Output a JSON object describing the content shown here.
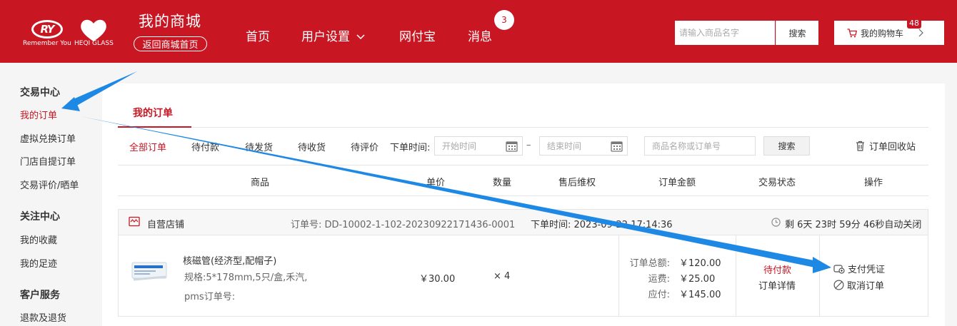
{
  "header": {
    "logo_ry": "RY",
    "logo_ry_sub": "Remember You",
    "logo_heqi_sub": "HEQI GLASS",
    "store_title": "我的商城",
    "back_home": "返回商城首页",
    "nav": [
      {
        "label": "首页"
      },
      {
        "label": "用户设置"
      },
      {
        "label": "网付宝"
      },
      {
        "label": "消息"
      }
    ],
    "message_count": "3",
    "search_placeholder": "请输入商品名字",
    "search_button": "搜索",
    "cart_label": "我的购物车",
    "cart_count": "48",
    "brand_color": "#c81623"
  },
  "sidebar": {
    "sections": [
      {
        "title": "交易中心",
        "items": [
          "我的订单",
          "虚拟兑换订单",
          "门店自提订单",
          "交易评价/晒单"
        ]
      },
      {
        "title": "关注中心",
        "items": [
          "我的收藏",
          "我的足迹"
        ]
      },
      {
        "title": "客户服务",
        "items": [
          "退款及退货"
        ]
      }
    ],
    "active_item": "我的订单"
  },
  "main": {
    "tab": "我的订单",
    "filters": [
      "全部订单",
      "待付款",
      "待发货",
      "待收货",
      "待评价"
    ],
    "active_filter": "全部订单",
    "time_label": "下单时间:",
    "start_placeholder": "开始时间",
    "range_sep": "–",
    "end_placeholder": "结束时间",
    "keyword_placeholder": "商品名称或订单号",
    "search_button": "搜索",
    "recycle_bin": "订单回收站",
    "columns": [
      "商品",
      "单价",
      "数量",
      "售后维权",
      "订单金额",
      "交易状态",
      "操作"
    ]
  },
  "order": {
    "store": "自营店铺",
    "order_no": "订单号:  DD-10002-1-102-20230922171436-0001",
    "order_time": "下单时间:  2023-09-22 17:14:36",
    "countdown": "剩 6天 23时 59分 46秒自动关闭",
    "product": {
      "name": "核磁管(经济型,配帽子)",
      "spec": "规格:5*178mm,5只/盒,禾汽,",
      "pms": "pms订单号:",
      "price": "￥30.00",
      "qty": "× 4"
    },
    "total_label": "订单总额:",
    "total": "￥120.00",
    "shipping_label": "运费:",
    "shipping": "￥25.00",
    "payable_label": "应付:",
    "payable": "￥145.00",
    "status": "待付款",
    "detail": "订单详情",
    "pay_proof": "支付凭证",
    "cancel": "取消订单"
  }
}
